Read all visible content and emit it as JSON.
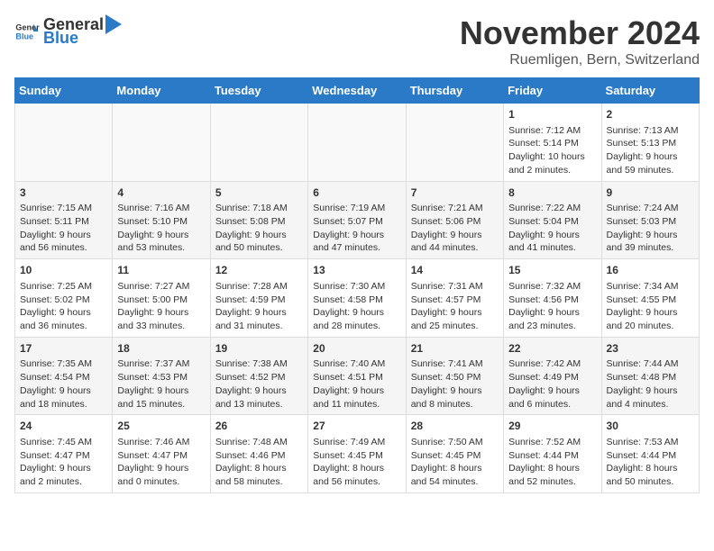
{
  "header": {
    "logo_general": "General",
    "logo_blue": "Blue",
    "month_title": "November 2024",
    "location": "Ruemligen, Bern, Switzerland"
  },
  "weekdays": [
    "Sunday",
    "Monday",
    "Tuesday",
    "Wednesday",
    "Thursday",
    "Friday",
    "Saturday"
  ],
  "weeks": [
    [
      {
        "day": "",
        "content": ""
      },
      {
        "day": "",
        "content": ""
      },
      {
        "day": "",
        "content": ""
      },
      {
        "day": "",
        "content": ""
      },
      {
        "day": "",
        "content": ""
      },
      {
        "day": "1",
        "content": "Sunrise: 7:12 AM\nSunset: 5:14 PM\nDaylight: 10 hours\nand 2 minutes."
      },
      {
        "day": "2",
        "content": "Sunrise: 7:13 AM\nSunset: 5:13 PM\nDaylight: 9 hours\nand 59 minutes."
      }
    ],
    [
      {
        "day": "3",
        "content": "Sunrise: 7:15 AM\nSunset: 5:11 PM\nDaylight: 9 hours\nand 56 minutes."
      },
      {
        "day": "4",
        "content": "Sunrise: 7:16 AM\nSunset: 5:10 PM\nDaylight: 9 hours\nand 53 minutes."
      },
      {
        "day": "5",
        "content": "Sunrise: 7:18 AM\nSunset: 5:08 PM\nDaylight: 9 hours\nand 50 minutes."
      },
      {
        "day": "6",
        "content": "Sunrise: 7:19 AM\nSunset: 5:07 PM\nDaylight: 9 hours\nand 47 minutes."
      },
      {
        "day": "7",
        "content": "Sunrise: 7:21 AM\nSunset: 5:06 PM\nDaylight: 9 hours\nand 44 minutes."
      },
      {
        "day": "8",
        "content": "Sunrise: 7:22 AM\nSunset: 5:04 PM\nDaylight: 9 hours\nand 41 minutes."
      },
      {
        "day": "9",
        "content": "Sunrise: 7:24 AM\nSunset: 5:03 PM\nDaylight: 9 hours\nand 39 minutes."
      }
    ],
    [
      {
        "day": "10",
        "content": "Sunrise: 7:25 AM\nSunset: 5:02 PM\nDaylight: 9 hours\nand 36 minutes."
      },
      {
        "day": "11",
        "content": "Sunrise: 7:27 AM\nSunset: 5:00 PM\nDaylight: 9 hours\nand 33 minutes."
      },
      {
        "day": "12",
        "content": "Sunrise: 7:28 AM\nSunset: 4:59 PM\nDaylight: 9 hours\nand 31 minutes."
      },
      {
        "day": "13",
        "content": "Sunrise: 7:30 AM\nSunset: 4:58 PM\nDaylight: 9 hours\nand 28 minutes."
      },
      {
        "day": "14",
        "content": "Sunrise: 7:31 AM\nSunset: 4:57 PM\nDaylight: 9 hours\nand 25 minutes."
      },
      {
        "day": "15",
        "content": "Sunrise: 7:32 AM\nSunset: 4:56 PM\nDaylight: 9 hours\nand 23 minutes."
      },
      {
        "day": "16",
        "content": "Sunrise: 7:34 AM\nSunset: 4:55 PM\nDaylight: 9 hours\nand 20 minutes."
      }
    ],
    [
      {
        "day": "17",
        "content": "Sunrise: 7:35 AM\nSunset: 4:54 PM\nDaylight: 9 hours\nand 18 minutes."
      },
      {
        "day": "18",
        "content": "Sunrise: 7:37 AM\nSunset: 4:53 PM\nDaylight: 9 hours\nand 15 minutes."
      },
      {
        "day": "19",
        "content": "Sunrise: 7:38 AM\nSunset: 4:52 PM\nDaylight: 9 hours\nand 13 minutes."
      },
      {
        "day": "20",
        "content": "Sunrise: 7:40 AM\nSunset: 4:51 PM\nDaylight: 9 hours\nand 11 minutes."
      },
      {
        "day": "21",
        "content": "Sunrise: 7:41 AM\nSunset: 4:50 PM\nDaylight: 9 hours\nand 8 minutes."
      },
      {
        "day": "22",
        "content": "Sunrise: 7:42 AM\nSunset: 4:49 PM\nDaylight: 9 hours\nand 6 minutes."
      },
      {
        "day": "23",
        "content": "Sunrise: 7:44 AM\nSunset: 4:48 PM\nDaylight: 9 hours\nand 4 minutes."
      }
    ],
    [
      {
        "day": "24",
        "content": "Sunrise: 7:45 AM\nSunset: 4:47 PM\nDaylight: 9 hours\nand 2 minutes."
      },
      {
        "day": "25",
        "content": "Sunrise: 7:46 AM\nSunset: 4:47 PM\nDaylight: 9 hours\nand 0 minutes."
      },
      {
        "day": "26",
        "content": "Sunrise: 7:48 AM\nSunset: 4:46 PM\nDaylight: 8 hours\nand 58 minutes."
      },
      {
        "day": "27",
        "content": "Sunrise: 7:49 AM\nSunset: 4:45 PM\nDaylight: 8 hours\nand 56 minutes."
      },
      {
        "day": "28",
        "content": "Sunrise: 7:50 AM\nSunset: 4:45 PM\nDaylight: 8 hours\nand 54 minutes."
      },
      {
        "day": "29",
        "content": "Sunrise: 7:52 AM\nSunset: 4:44 PM\nDaylight: 8 hours\nand 52 minutes."
      },
      {
        "day": "30",
        "content": "Sunrise: 7:53 AM\nSunset: 4:44 PM\nDaylight: 8 hours\nand 50 minutes."
      }
    ]
  ]
}
